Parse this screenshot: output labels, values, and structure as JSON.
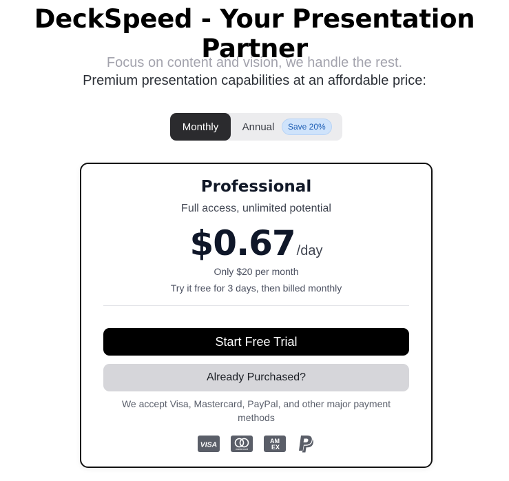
{
  "header": {
    "title": "DeckSpeed - Your Presentation Partner",
    "tagline": "Focus on content and vision, we handle the rest.",
    "subtagline": "Premium presentation capabilities at an affordable price:"
  },
  "billing_toggle": {
    "monthly_label": "Monthly",
    "annual_label": "Annual",
    "save_badge": "Save 20%",
    "selected": "Monthly"
  },
  "plan": {
    "name": "Professional",
    "description": "Full access, unlimited potential",
    "price": "$0.67",
    "price_unit": "/day",
    "price_note": "Only $20 per month",
    "trial_note": "Try it free for 3 days, then billed monthly",
    "primary_cta": "Start Free Trial",
    "secondary_cta": "Already Purchased?",
    "payment_note": "We accept Visa, Mastercard, PayPal, and other major payment methods",
    "payment_icons": [
      "visa-icon",
      "mastercard-icon",
      "amex-icon",
      "paypal-icon"
    ],
    "payment_icon_text": {
      "visa": "VISA",
      "mastercard": "mastercard",
      "amex_top": "AM",
      "amex_bottom": "EX"
    }
  },
  "colors": {
    "accent_dark": "#2b2b2e",
    "badge_bg": "#cfe3fb",
    "badge_text": "#1f5fb5",
    "primary_button": "#000000",
    "secondary_button": "#d6d6da",
    "icon_gray": "#5a5e68"
  }
}
